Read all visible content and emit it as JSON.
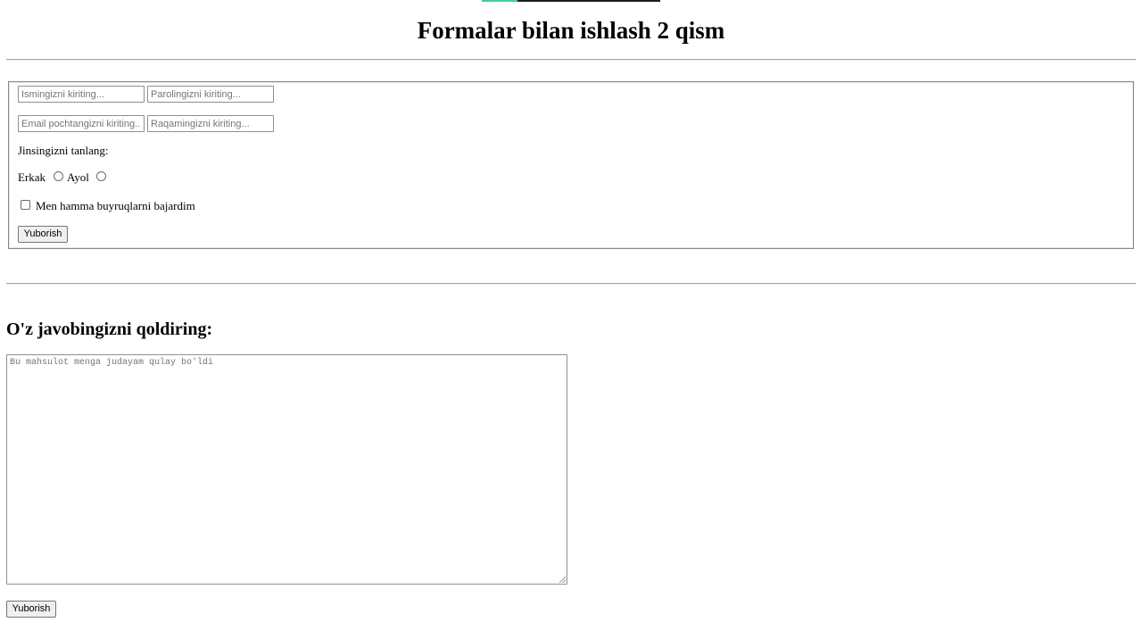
{
  "page": {
    "title": "Formalar bilan ishlash 2 qism"
  },
  "form": {
    "name_placeholder": "Ismingizni kiriting...",
    "password_placeholder": "Parolingizni kiriting...",
    "email_placeholder": "Email pochtangizni kiriting...",
    "phone_placeholder": "Raqamingizni kiriting...",
    "gender_label": "Jinsingizni tanlang:",
    "gender_options": [
      "Erkak",
      "Ayol"
    ],
    "agree_label": "Men hamma buyruqlarni bajardim",
    "submit_label": "Yuborish"
  },
  "feedback": {
    "title": "O'z javobingizni qoldiring:",
    "textarea_placeholder": "Bu mahsulot menga judayam qulay bo'ldi",
    "submit_label": "Yuborish"
  },
  "colors": {
    "accent": "#3fcf9a",
    "border": "#8f8f8f",
    "button_bg": "#efefef"
  }
}
